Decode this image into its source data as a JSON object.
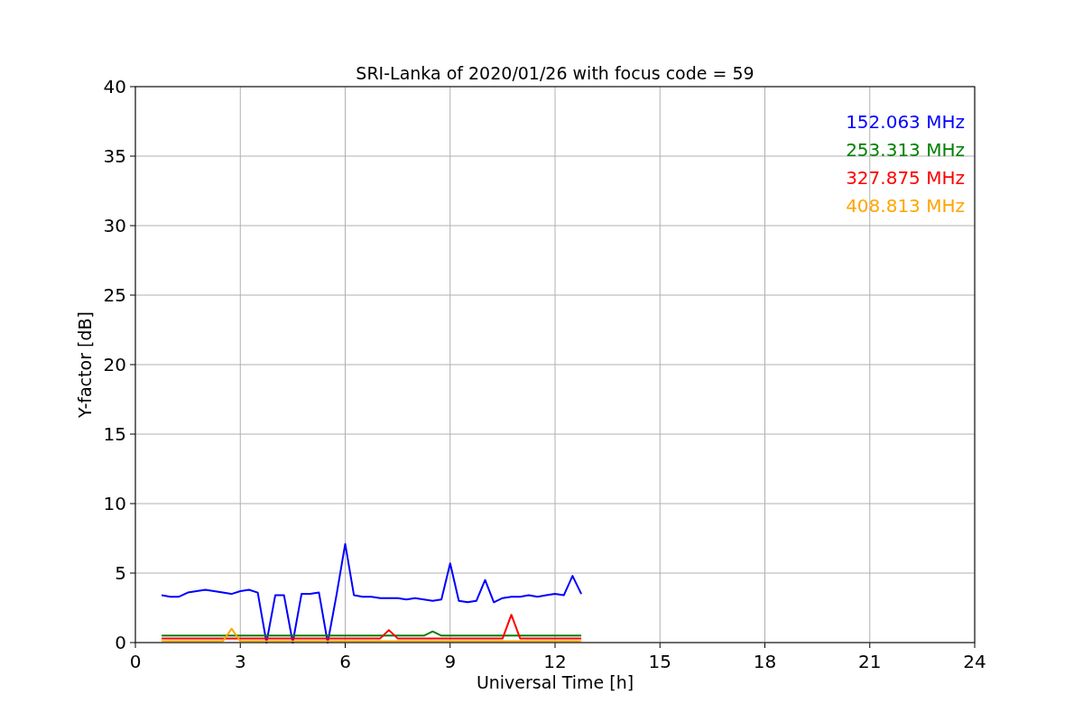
{
  "chart_data": {
    "type": "line",
    "title": "SRI-Lanka of 2020/01/26 with focus code = 59",
    "xlabel": "Universal Time [h]",
    "ylabel": "Y-factor [dB]",
    "x": [
      0.75,
      1.0,
      1.25,
      1.5,
      1.75,
      2.0,
      2.25,
      2.5,
      2.75,
      3.0,
      3.25,
      3.5,
      3.75,
      4.0,
      4.25,
      4.5,
      4.75,
      5.0,
      5.25,
      5.5,
      5.75,
      6.0,
      6.25,
      6.5,
      6.75,
      7.0,
      7.25,
      7.5,
      7.75,
      8.0,
      8.25,
      8.5,
      8.75,
      9.0,
      9.25,
      9.5,
      9.75,
      10.0,
      10.25,
      10.5,
      10.75,
      11.0,
      11.25,
      11.5,
      11.75,
      12.0,
      12.25,
      12.5,
      12.75
    ],
    "series": [
      {
        "name": "152.063 MHz",
        "color": "#0000ff",
        "values": [
          3.4,
          3.3,
          3.3,
          3.6,
          3.7,
          3.8,
          3.7,
          3.6,
          3.5,
          3.7,
          3.8,
          3.6,
          0.0,
          3.4,
          3.4,
          0.0,
          3.5,
          3.5,
          3.6,
          0.0,
          3.4,
          7.1,
          3.4,
          3.3,
          3.3,
          3.2,
          3.2,
          3.2,
          3.1,
          3.2,
          3.1,
          3.0,
          3.1,
          5.7,
          3.0,
          2.9,
          3.0,
          4.5,
          2.9,
          3.2,
          3.3,
          3.3,
          3.4,
          3.3,
          3.4,
          3.5,
          3.4,
          4.8,
          3.5
        ]
      },
      {
        "name": "253.313 MHz",
        "color": "#008000",
        "values": [
          0.5,
          0.5,
          0.5,
          0.5,
          0.5,
          0.5,
          0.5,
          0.5,
          0.5,
          0.5,
          0.5,
          0.5,
          0.5,
          0.5,
          0.5,
          0.5,
          0.5,
          0.5,
          0.5,
          0.5,
          0.5,
          0.5,
          0.5,
          0.5,
          0.5,
          0.5,
          0.5,
          0.5,
          0.5,
          0.5,
          0.5,
          0.8,
          0.5,
          0.5,
          0.5,
          0.5,
          0.5,
          0.5,
          0.5,
          0.5,
          0.5,
          0.5,
          0.5,
          0.5,
          0.5,
          0.5,
          0.5,
          0.5,
          0.5
        ]
      },
      {
        "name": "327.875 MHz",
        "color": "#ff0000",
        "values": [
          0.3,
          0.3,
          0.3,
          0.3,
          0.3,
          0.3,
          0.3,
          0.3,
          0.3,
          0.3,
          0.3,
          0.3,
          0.3,
          0.3,
          0.3,
          0.3,
          0.3,
          0.3,
          0.3,
          0.3,
          0.3,
          0.3,
          0.3,
          0.3,
          0.3,
          0.3,
          0.9,
          0.3,
          0.3,
          0.3,
          0.3,
          0.3,
          0.3,
          0.3,
          0.3,
          0.3,
          0.3,
          0.3,
          0.3,
          0.3,
          2.0,
          0.3,
          0.3,
          0.3,
          0.3,
          0.3,
          0.3,
          0.3,
          0.3
        ]
      },
      {
        "name": "408.813 MHz",
        "color": "#ffa500",
        "values": [
          0.1,
          0.1,
          0.1,
          0.1,
          0.1,
          0.1,
          0.1,
          0.1,
          1.0,
          0.1,
          0.1,
          0.1,
          0.1,
          0.1,
          0.1,
          0.1,
          0.1,
          0.1,
          0.1,
          0.1,
          0.1,
          0.1,
          0.1,
          0.1,
          0.1,
          0.1,
          0.1,
          0.1,
          0.1,
          0.1,
          0.1,
          0.1,
          0.1,
          0.1,
          0.1,
          0.1,
          0.1,
          0.1,
          0.1,
          0.1,
          0.1,
          0.1,
          0.1,
          0.1,
          0.1,
          0.1,
          0.1,
          0.1,
          0.1
        ]
      }
    ],
    "xlim": [
      0,
      24
    ],
    "ylim": [
      0,
      40
    ],
    "xticks": [
      0,
      3,
      6,
      9,
      12,
      15,
      18,
      21,
      24
    ],
    "yticks": [
      0,
      5,
      10,
      15,
      20,
      25,
      30,
      35,
      40
    ],
    "grid": true
  }
}
